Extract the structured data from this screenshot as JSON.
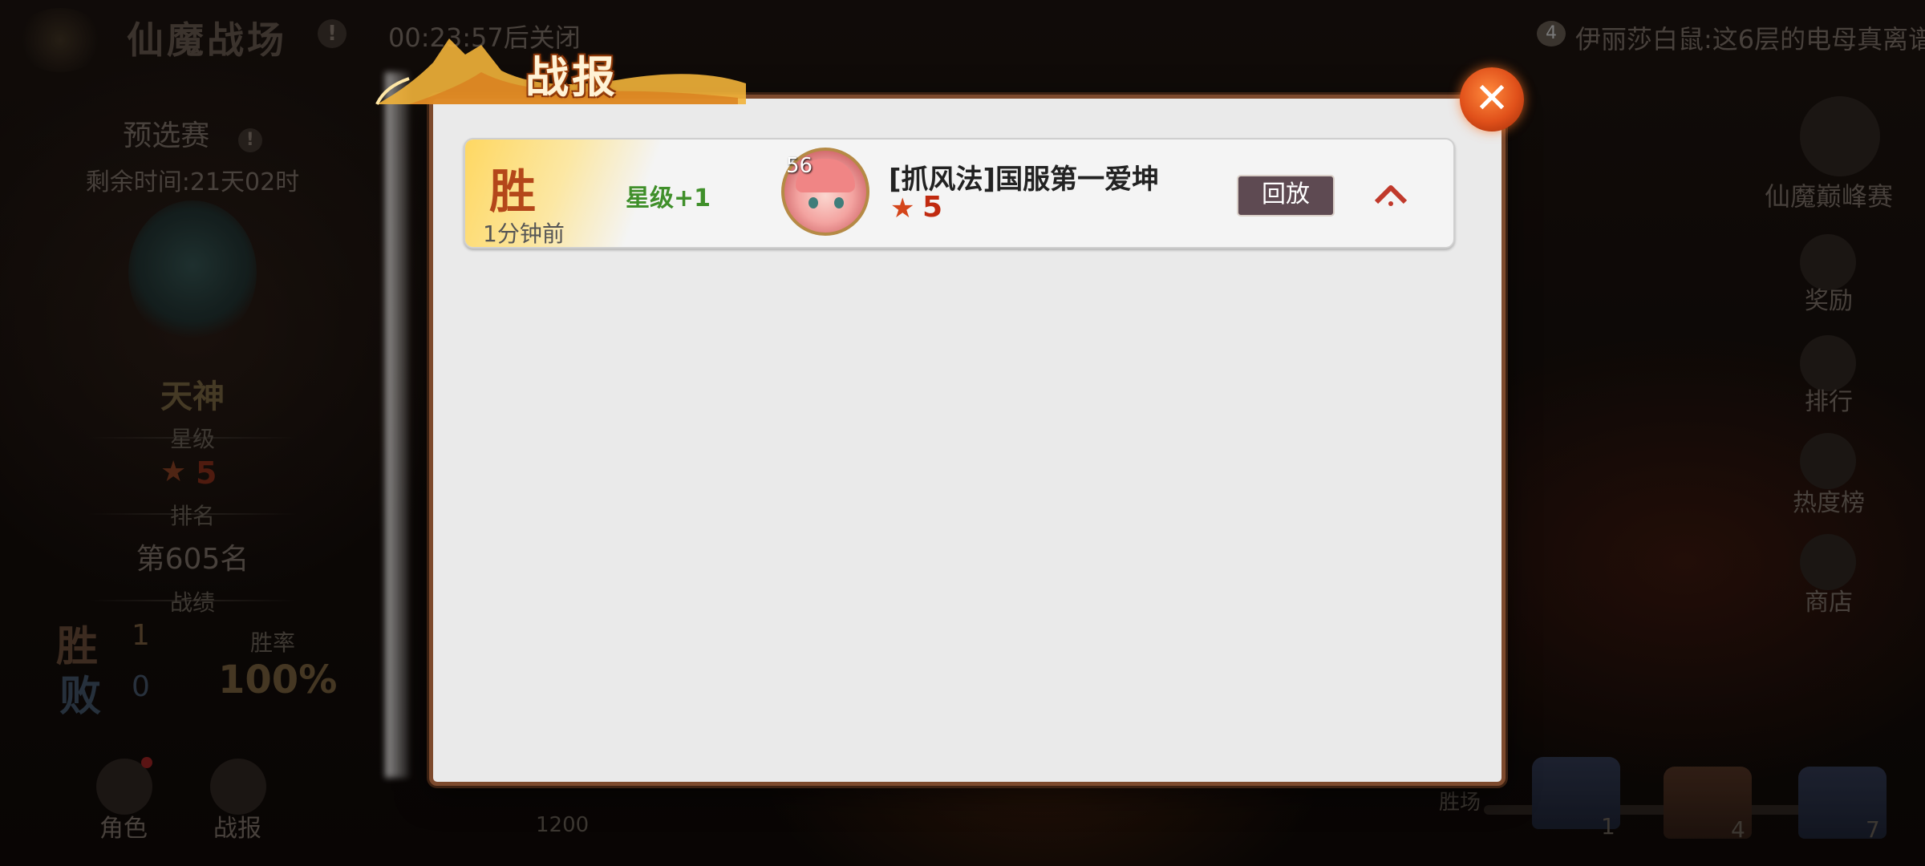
{
  "top_bar": {
    "title": "仙魔战场",
    "title_info": "!",
    "timer": "00:23:57后关闭",
    "chat_count": "4",
    "chat_message": "伊丽莎白鼠:这6层的电母真离谱"
  },
  "left_panel": {
    "stage": "预选赛",
    "stage_info": "!",
    "remaining_time": "剩余时间:21天02时",
    "rank_title": "天神",
    "star_label": "星级",
    "star_value": "5",
    "rank_label": "排名",
    "rank_value": "第605名",
    "record_label": "战绩",
    "win_label": "胜",
    "win_count": "1",
    "loss_label": "败",
    "loss_count": "0",
    "win_rate_label": "胜率",
    "win_rate": "100%"
  },
  "right_menu": {
    "peak": "仙魔巅峰赛",
    "reward": "奖励",
    "ranking": "排行",
    "heat": "热度榜",
    "shop": "商店"
  },
  "bottom_bar": {
    "role": "角色",
    "report": "战报",
    "score": "1200",
    "wins_label": "胜场",
    "chest1": "1",
    "chest2": "4",
    "chest3": "7"
  },
  "dialog": {
    "title": "战报",
    "close": "✕",
    "records": [
      {
        "result": "胜",
        "time_ago": "1分钟前",
        "star_change": "星级+1",
        "opponent_level": "56",
        "opponent_name": "[抓风法]国服第一爱坤",
        "opponent_star": "5",
        "replay_label": "回放"
      }
    ]
  }
}
